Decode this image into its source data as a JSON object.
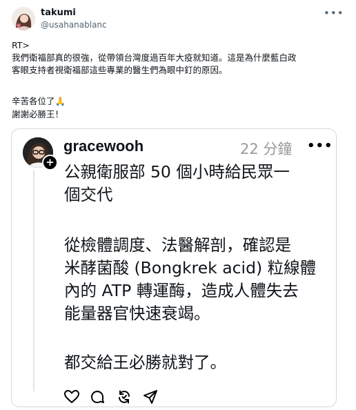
{
  "tweet": {
    "author_name": "takumi",
    "author_handle": "@usahanablanc",
    "lines": [
      "RT>",
      "我們衛福部真的很強，從帶領台灣度過百年大疫就知道。這是為什麼藍白政",
      "客眼支持者視衛福部這些專業的醫生們為眼中釘的原因。",
      "",
      "辛苦各位了🙏",
      "謝謝必勝王！"
    ]
  },
  "quote": {
    "username": "gracewooh",
    "time": "22 分鐘",
    "body_lines": [
      "公親衛服部 50 個小時給民眾一",
      "個交代",
      "",
      "從檢體調度、法醫解剖，確認是",
      "米酵菌酸 (Bongkrek acid) 粒線體",
      "內的 ATP 轉運酶，造成人體失去",
      "能量器官快速衰竭。",
      "",
      "都交給王必勝就對了。"
    ]
  },
  "icons": {
    "more": "more-horizontal-icon",
    "plus": "plus-badge-icon",
    "like": "heart-icon",
    "reply": "comment-icon",
    "repost": "repost-icon",
    "share": "send-icon"
  },
  "colors": {
    "text": "#0f1419",
    "secondary": "#536471",
    "time_gray": "#999999",
    "border": "#cfd9de"
  }
}
